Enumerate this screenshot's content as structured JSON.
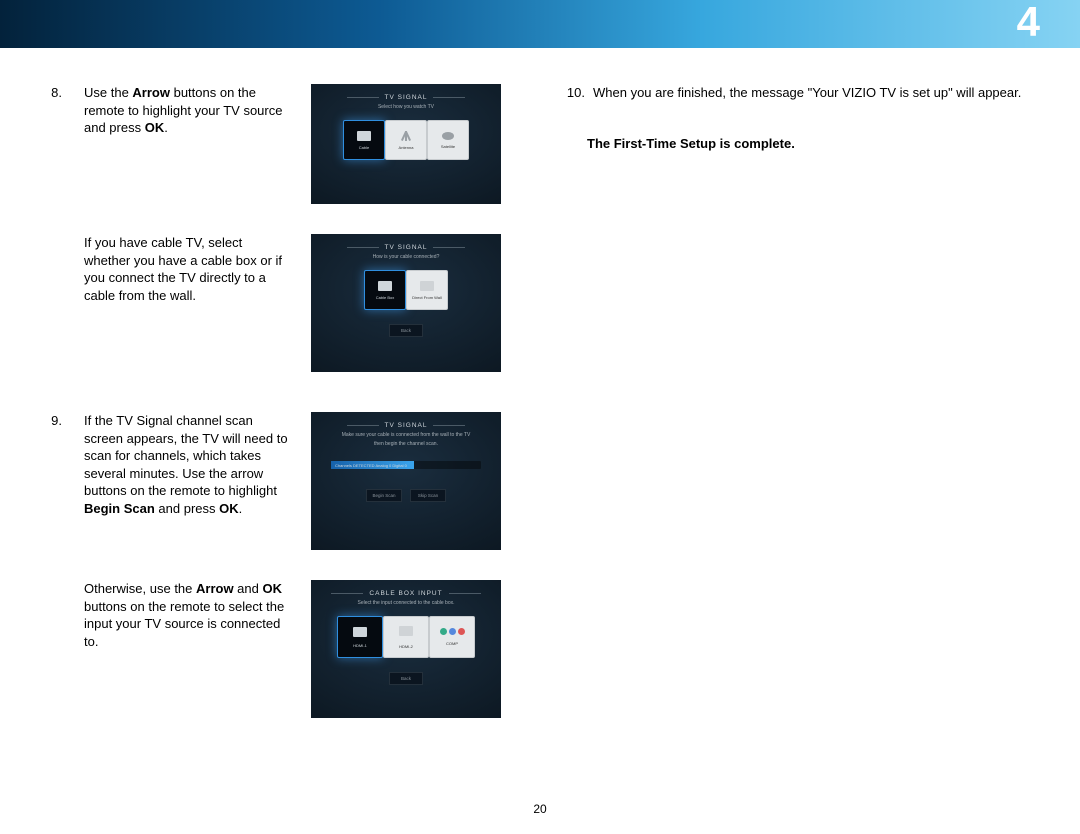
{
  "chapter": "4",
  "page_number": "20",
  "left": {
    "step8": {
      "num": "8.",
      "text_pre": "Use the ",
      "arrow": "Arrow",
      "text_mid": " buttons on the remote to highlight your TV source and press ",
      "ok": "OK",
      "text_post": "."
    },
    "cable_note": "If you have cable TV, select whether you have a cable box or if you connect the TV directly to a cable from the wall.",
    "step9": {
      "num": "9.",
      "text_a": "If the TV Signal channel scan screen appears, the TV will need to scan for channels, which takes several minutes. Use the arrow buttons on the remote to highlight ",
      "begin": "Begin Scan",
      "text_b": " and press ",
      "ok": "OK",
      "text_post": "."
    },
    "otherwise": {
      "text_pre": "Otherwise, use the ",
      "arrow": "Arrow",
      "text_mid": " and ",
      "ok": "OK",
      "text_post": " buttons on the remote to select the input your TV source is connected to."
    }
  },
  "right": {
    "step10": {
      "num": "10.",
      "text": "When you are finished, the message \"Your VIZIO TV is set up\" will appear."
    },
    "complete": "The First-Time Setup is complete."
  },
  "shots": {
    "s1": {
      "title": "TV SIGNAL",
      "sub": "Select how you watch TV",
      "opt1": "Cable",
      "opt2": "Antenna",
      "opt3": "Satellite"
    },
    "s2": {
      "title": "TV SIGNAL",
      "sub": "How is your cable connected?",
      "opt1": "Cable Box",
      "opt2": "Direct From Wall",
      "back": "Back"
    },
    "s3": {
      "title": "TV SIGNAL",
      "sub1": "Make sure your cable is connected from the wall to the TV",
      "sub2": "then begin the channel scan.",
      "progress": "Channels DETECTED  Analog 0  Digital 0",
      "btn1": "Begin Scan",
      "btn2": "Skip Scan"
    },
    "s4": {
      "title": "CABLE BOX INPUT",
      "sub": "Select the input connected to the cable box.",
      "opt1": "HDMI-1",
      "opt2": "HDMI-2",
      "opt3": "COMP",
      "back": "Back"
    }
  }
}
